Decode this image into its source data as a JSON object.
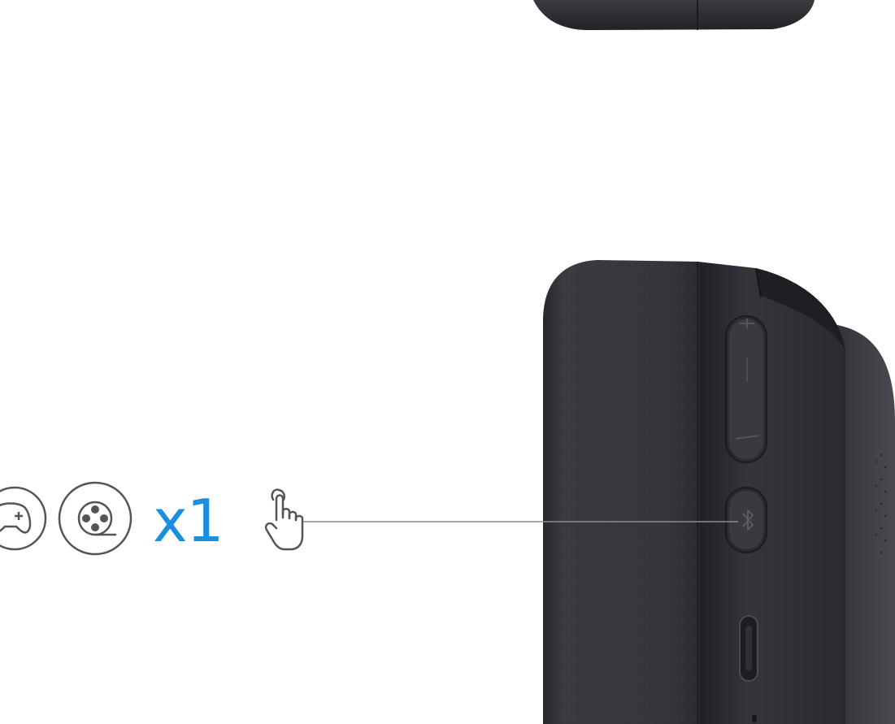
{
  "instruction": {
    "press_count": "x1",
    "mode_icons": [
      "gamepad-icon",
      "film-reel-icon"
    ],
    "gesture_icon": "tap-hand-icon"
  },
  "headphone": {
    "buttons": [
      "volume-rocker",
      "bluetooth-button",
      "usb-c-port"
    ],
    "button_icons": [
      "plus-icon",
      "minus-icon",
      "bluetooth-icon"
    ]
  },
  "colors": {
    "accent": "#1a8fe0",
    "icon_stroke": "#555555",
    "leader_line": "#8c8c8c",
    "earcup_dark": "#2e2f33",
    "earcup_mid": "#3a3b40",
    "button_face": "#35363b"
  }
}
